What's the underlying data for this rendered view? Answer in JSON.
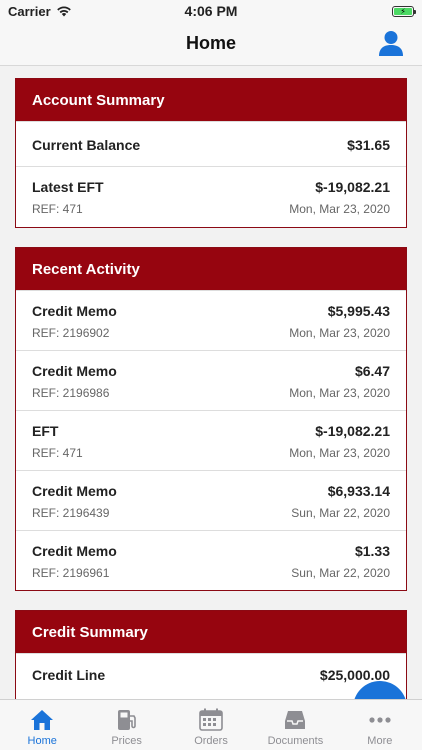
{
  "status": {
    "carrier": "Carrier",
    "time": "4:06 PM"
  },
  "nav": {
    "title": "Home"
  },
  "account_summary": {
    "title": "Account Summary",
    "current_balance_label": "Current Balance",
    "current_balance_value": "$31.65",
    "latest_eft_label": "Latest EFT",
    "latest_eft_value": "$-19,082.21",
    "latest_eft_ref": "REF: 471",
    "latest_eft_date": "Mon, Mar 23, 2020"
  },
  "recent_activity": {
    "title": "Recent Activity",
    "items": [
      {
        "type": "Credit Memo",
        "amount": "$5,995.43",
        "ref": "REF: 2196902",
        "date": "Mon, Mar 23, 2020"
      },
      {
        "type": "Credit Memo",
        "amount": "$6.47",
        "ref": "REF: 2196986",
        "date": "Mon, Mar 23, 2020"
      },
      {
        "type": "EFT",
        "amount": "$-19,082.21",
        "ref": "REF: 471",
        "date": "Mon, Mar 23, 2020"
      },
      {
        "type": "Credit Memo",
        "amount": "$6,933.14",
        "ref": "REF: 2196439",
        "date": "Sun, Mar 22, 2020"
      },
      {
        "type": "Credit Memo",
        "amount": "$1.33",
        "ref": "REF: 2196961",
        "date": "Sun, Mar 22, 2020"
      }
    ]
  },
  "credit_summary": {
    "title": "Credit Summary",
    "credit_line_label": "Credit Line",
    "credit_line_value": "$25,000.00"
  },
  "tabs": [
    {
      "label": "Home",
      "icon": "house-icon"
    },
    {
      "label": "Prices",
      "icon": "fuel-pump-icon"
    },
    {
      "label": "Orders",
      "icon": "calendar-icon"
    },
    {
      "label": "Documents",
      "icon": "inbox-tray-icon"
    },
    {
      "label": "More",
      "icon": "ellipsis-icon"
    }
  ],
  "colors": {
    "brand_red": "#96050f",
    "accent_blue": "#1a73d9"
  }
}
